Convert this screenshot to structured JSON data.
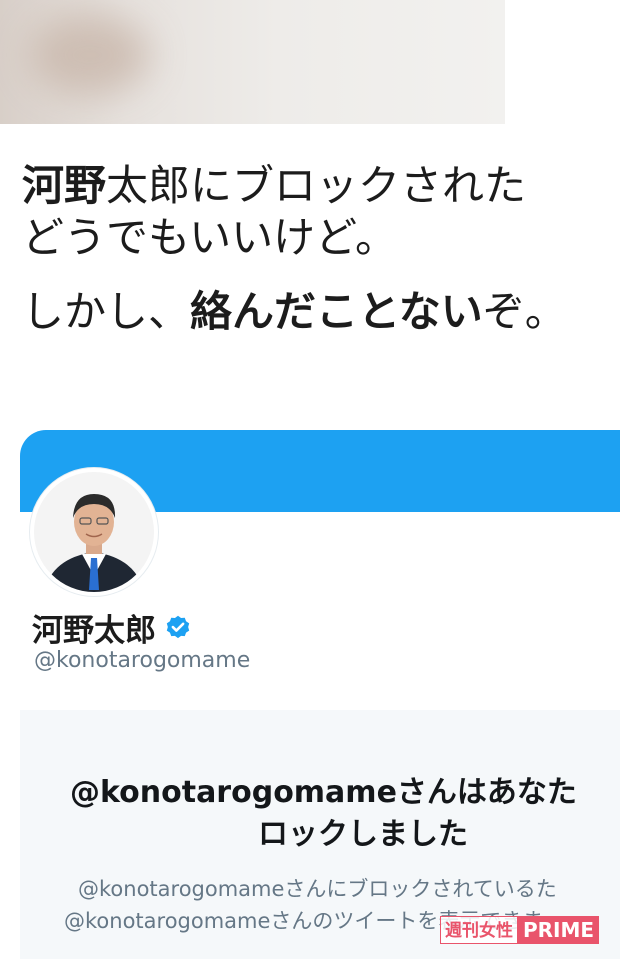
{
  "tweet": {
    "line1_bold": "河野",
    "line1_rest": "太郎にブロックされた",
    "line2": "どうでもいいけど。",
    "line3_pre": "しかし、",
    "line3_bold": "絡んだことない",
    "line3_post": "ぞ。"
  },
  "profile": {
    "display_name": "河野太郎",
    "handle": "@konotarogomame",
    "verified_icon": "verified-badge-icon",
    "banner_color": "#1da1f2"
  },
  "blocked_notice": {
    "title_line1": "@konotarogomameさんはあなた",
    "title_line2": "ロックしました",
    "desc_line1": "@konotarogomameさんにブロックされているた",
    "desc_line2": "@konotarogomameさんのツイートを表示できま"
  },
  "watermark": {
    "left": "週刊女性",
    "right": "PRIME",
    "color": "#e9546b"
  }
}
